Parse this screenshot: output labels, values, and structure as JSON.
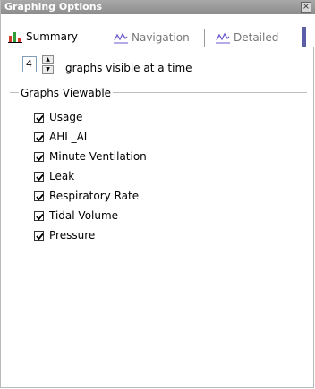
{
  "window": {
    "title": "Graphing Options",
    "close_glyph": "×"
  },
  "tabs": [
    {
      "label": "Summary",
      "icon": "bar-chart-icon",
      "active": true
    },
    {
      "label": "Navigation",
      "icon": "line-chart-icon",
      "active": false
    },
    {
      "label": "Detailed",
      "icon": "line-chart-icon",
      "active": false
    }
  ],
  "graphs_visible": {
    "value": "4",
    "label": "graphs visible at a time"
  },
  "graphs_viewable": {
    "title": "Graphs Viewable",
    "items": [
      {
        "label": "Usage",
        "checked": true
      },
      {
        "label": "AHI _AI",
        "checked": true
      },
      {
        "label": "Minute Ventilation",
        "checked": true
      },
      {
        "label": "Leak",
        "checked": true
      },
      {
        "label": "Respiratory Rate",
        "checked": true
      },
      {
        "label": "Tidal Volume",
        "checked": true
      },
      {
        "label": "Pressure",
        "checked": true
      }
    ]
  },
  "colors": {
    "titlebar": "#9a9a9a",
    "tab_accent": "#5a5fa8",
    "chart_red": "#d63a2a",
    "chart_green": "#2e9e3a"
  }
}
